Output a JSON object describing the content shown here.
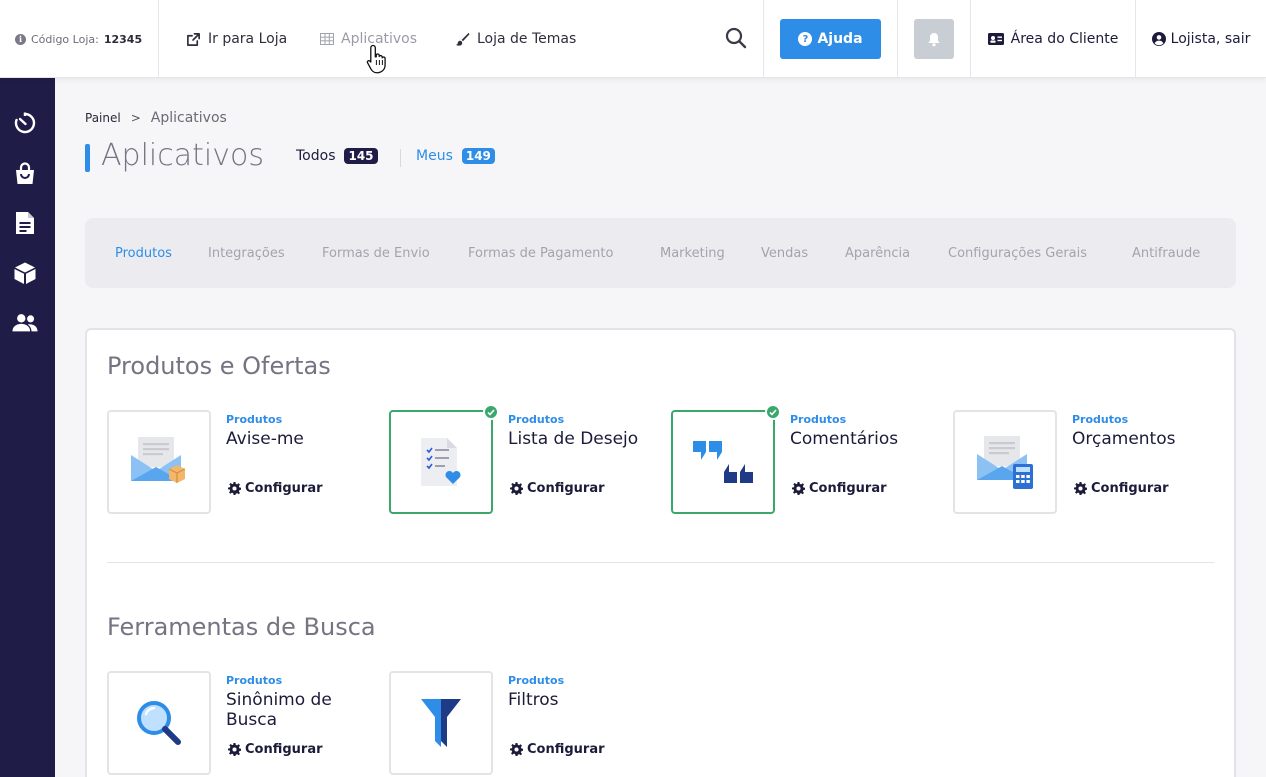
{
  "colors": {
    "accent": "#2e8de6",
    "sidebar": "#1f1d47",
    "installed": "#3aa76d"
  },
  "topbar": {
    "store_code_label": "Código Loja:",
    "store_code_value": "12345",
    "links": [
      {
        "label": "Ir para Loja",
        "icon": "external-link-icon"
      },
      {
        "label": "Aplicativos",
        "icon": "grid-icon"
      },
      {
        "label": "Loja de Temas",
        "icon": "brush-icon"
      }
    ],
    "help_label": "Ajuda",
    "client_area_label": "Área do Cliente",
    "logout_label": "Lojista, sair"
  },
  "sidebar": {
    "items": [
      {
        "icon": "dashboard-timer-icon"
      },
      {
        "icon": "shopping-bag-icon"
      },
      {
        "icon": "document-icon"
      },
      {
        "icon": "box-icon"
      },
      {
        "icon": "users-icon"
      }
    ]
  },
  "breadcrumb": {
    "root": "Painel",
    "separator": ">",
    "current": "Aplicativos"
  },
  "page": {
    "title": "Aplicativos",
    "tabs": [
      {
        "label": "Todos",
        "count": "145"
      },
      {
        "label": "Meus",
        "count": "149"
      }
    ]
  },
  "categories": [
    "Produtos",
    "Integrações",
    "Formas de Envio",
    "Formas de Pagamento",
    "Marketing",
    "Vendas",
    "Aparência",
    "Configurações Gerais",
    "Antifraude"
  ],
  "sections": [
    {
      "title": "Produtos e Ofertas",
      "apps": [
        {
          "category": "Produtos",
          "name": "Avise-me",
          "action": "Configurar",
          "installed": false,
          "icon": "envelope-box-icon"
        },
        {
          "category": "Produtos",
          "name": "Lista de Desejo",
          "action": "Configurar",
          "installed": true,
          "icon": "wishlist-icon"
        },
        {
          "category": "Produtos",
          "name": "Comentários",
          "action": "Configurar",
          "installed": true,
          "icon": "comments-icon"
        },
        {
          "category": "Produtos",
          "name": "Orçamentos",
          "action": "Configurar",
          "installed": false,
          "icon": "envelope-calculator-icon"
        }
      ]
    },
    {
      "title": "Ferramentas de Busca",
      "apps": [
        {
          "category": "Produtos",
          "name": "Sinônimo de Busca",
          "action": "Configurar",
          "installed": false,
          "icon": "magnifier-icon"
        },
        {
          "category": "Produtos",
          "name": "Filtros",
          "action": "Configurar",
          "installed": false,
          "icon": "funnel-icon"
        }
      ]
    }
  ]
}
